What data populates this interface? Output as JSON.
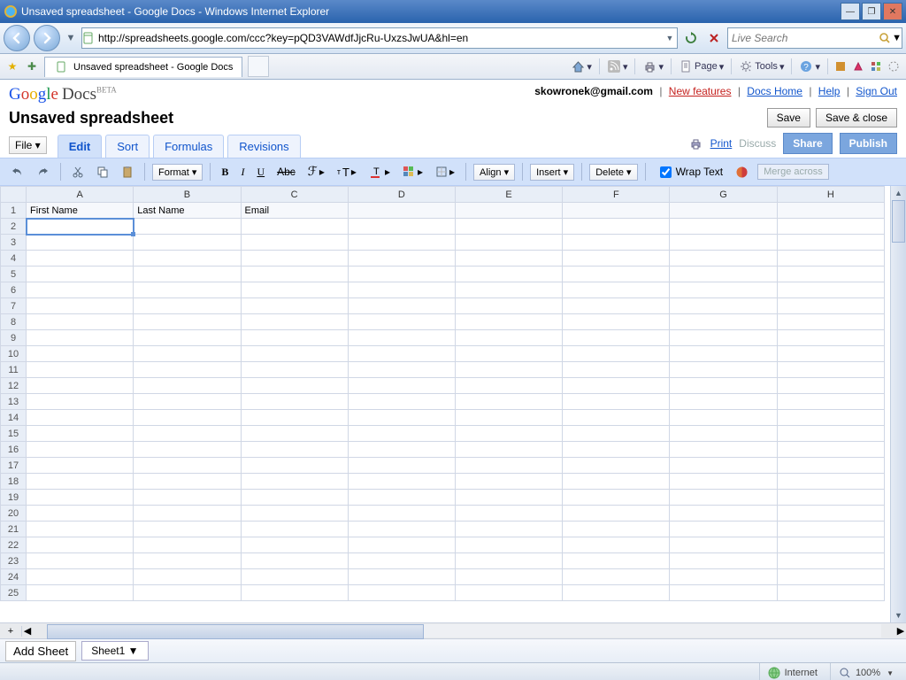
{
  "window": {
    "title": "Unsaved spreadsheet - Google Docs - Windows Internet Explorer"
  },
  "address_bar": {
    "url": "http://spreadsheets.google.com/ccc?key=pQD3VAWdfJjcRu-UxzsJwUA&hl=en"
  },
  "search_box": {
    "placeholder": "Live Search"
  },
  "browser_tab": {
    "title": "Unsaved spreadsheet - Google Docs"
  },
  "ie_tools": {
    "page": "Page",
    "tools": "Tools"
  },
  "logo": {
    "docs": "Docs",
    "beta": "BETA"
  },
  "header_links": {
    "email": "skowronek@gmail.com",
    "new_features": "New features",
    "docs_home": "Docs Home",
    "help": "Help",
    "sign_out": "Sign Out"
  },
  "doc_title": "Unsaved spreadsheet",
  "save_buttons": {
    "save": "Save",
    "save_close": "Save & close"
  },
  "file_menu": "File",
  "tabs": {
    "edit": "Edit",
    "sort": "Sort",
    "formulas": "Formulas",
    "revisions": "Revisions"
  },
  "right_tabs": {
    "print": "Print",
    "discuss": "Discuss",
    "share": "Share",
    "publish": "Publish"
  },
  "toolbar": {
    "format": "Format",
    "align": "Align",
    "insert": "Insert",
    "delete": "Delete",
    "wrap_text": "Wrap Text",
    "merge": "Merge across"
  },
  "columns": [
    "A",
    "B",
    "C",
    "D",
    "E",
    "F",
    "G",
    "H"
  ],
  "rows": [
    "1",
    "2",
    "3",
    "4",
    "5",
    "6",
    "7",
    "8",
    "9",
    "10",
    "11",
    "12",
    "13",
    "14",
    "15",
    "16",
    "17",
    "18",
    "19",
    "20",
    "21",
    "22",
    "23",
    "24",
    "25"
  ],
  "cells": {
    "r1": {
      "A": "First Name",
      "B": "Last Name",
      "C": "Email"
    }
  },
  "selected_cell": "A2",
  "footer": {
    "add_sheet": "Add Sheet",
    "sheet1": "Sheet1"
  },
  "status": {
    "zone": "Internet",
    "zoom": "100%"
  }
}
